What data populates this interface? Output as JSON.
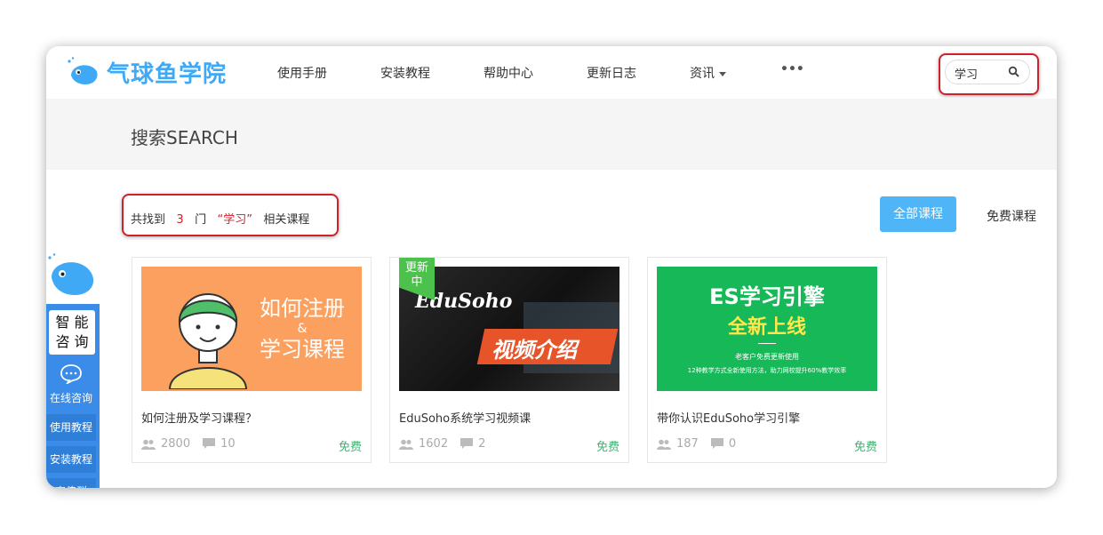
{
  "header": {
    "logo_text": "气球鱼学院",
    "nav": [
      {
        "label": "使用手册"
      },
      {
        "label": "安装教程"
      },
      {
        "label": "帮助中心"
      },
      {
        "label": "更新日志"
      },
      {
        "label": "资讯"
      },
      {
        "label": "•••"
      }
    ],
    "search_value": "学习"
  },
  "banner": {
    "title": "搜索SEARCH"
  },
  "result": {
    "prefix": "共找到",
    "count": "3",
    "unit": "门",
    "keyword": "“学习”",
    "suffix": "相关课程"
  },
  "filters": {
    "all": "全部课程",
    "free": "免费课程"
  },
  "courses": [
    {
      "title": "如何注册及学习课程？",
      "students": "2800",
      "comments": "10",
      "price": "免费",
      "thumb_text_1": "如何注册",
      "thumb_text_2": "&",
      "thumb_text_3": "学习课程"
    },
    {
      "title": "EduSoho系统学习视频课",
      "students": "1602",
      "comments": "2",
      "price": "免费",
      "badge": "更新中",
      "thumb_text_1": "EduSoho",
      "thumb_text_2": "视频介绍"
    },
    {
      "title": "带你认识EduSoho学习引擎",
      "students": "187",
      "comments": "0",
      "price": "免费",
      "thumb_text_1": "ES学习引擎",
      "thumb_text_2": "全新上线",
      "thumb_text_3": "老客户免费更新使用",
      "thumb_text_4": "12种教学方式全新使用方法，助力网校提升60%教学效率"
    }
  ],
  "side": {
    "box_text_1": "智 能",
    "box_text_2": "咨 询",
    "online": "在线咨询",
    "item1": "使用教程",
    "item2": "安装教程",
    "item3": "宣传群"
  },
  "colors": {
    "brand": "#3fa9f5",
    "highlight": "#d0202a",
    "free": "#3cb371",
    "sidebar": "#3b8be8"
  }
}
